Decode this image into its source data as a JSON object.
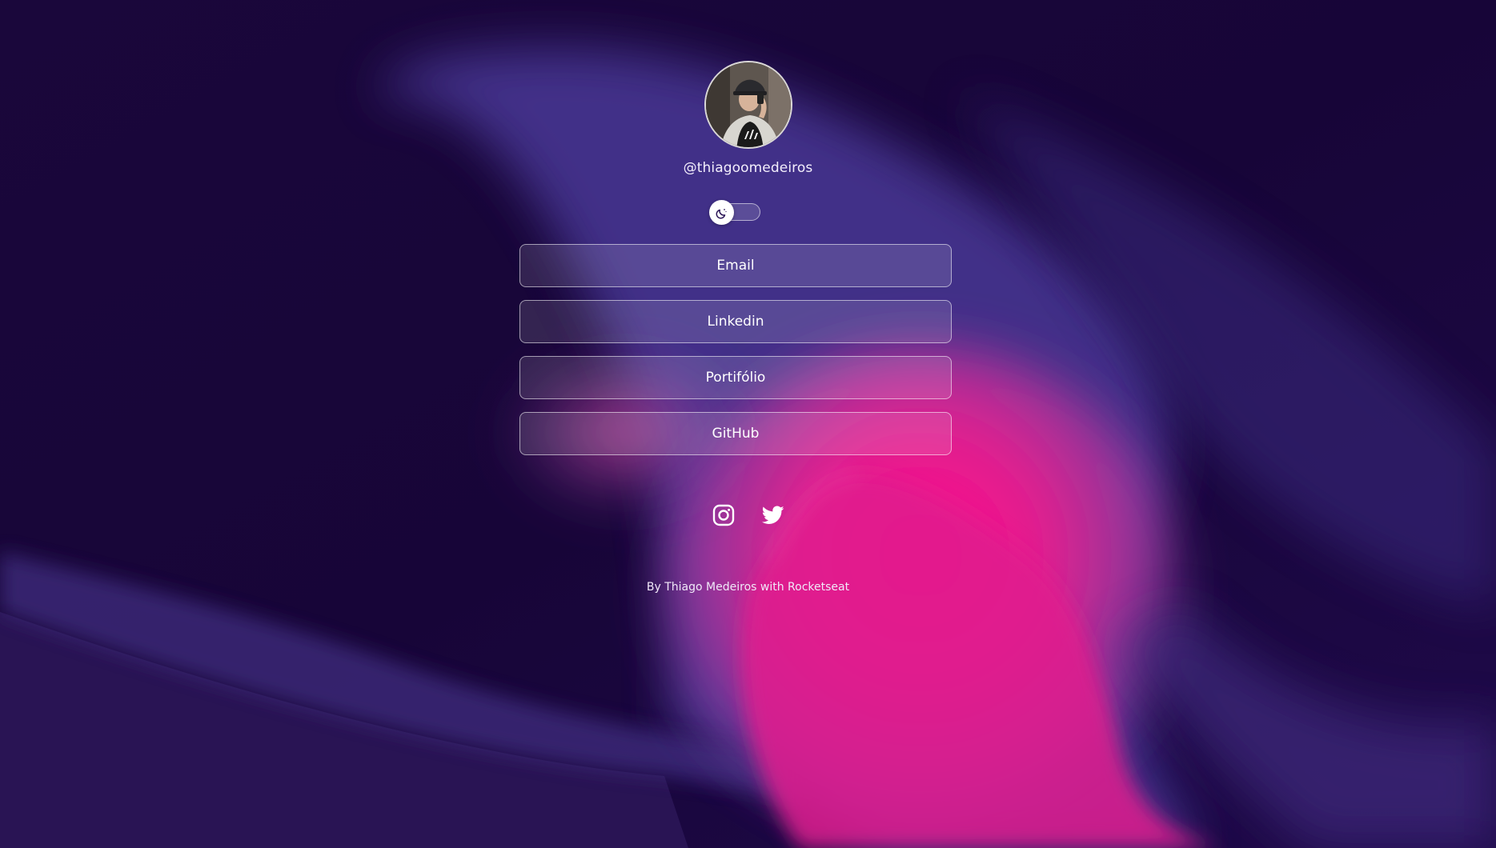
{
  "profile": {
    "username": "@thiagoomedeiros"
  },
  "theme_toggle": {
    "icon": "moon-icon",
    "state": "dark"
  },
  "links": [
    {
      "label": "Email"
    },
    {
      "label": "Linkedin"
    },
    {
      "label": "Portifólio"
    },
    {
      "label": "GitHub"
    }
  ],
  "socials": [
    {
      "icon": "instagram-icon"
    },
    {
      "icon": "twitter-icon"
    }
  ],
  "footer": {
    "text": "By Thiago Medeiros with Rocketseat"
  },
  "colors": {
    "background": "#170636",
    "accent_purple": "#5a3f9e",
    "accent_pink": "#ff0a8a"
  }
}
